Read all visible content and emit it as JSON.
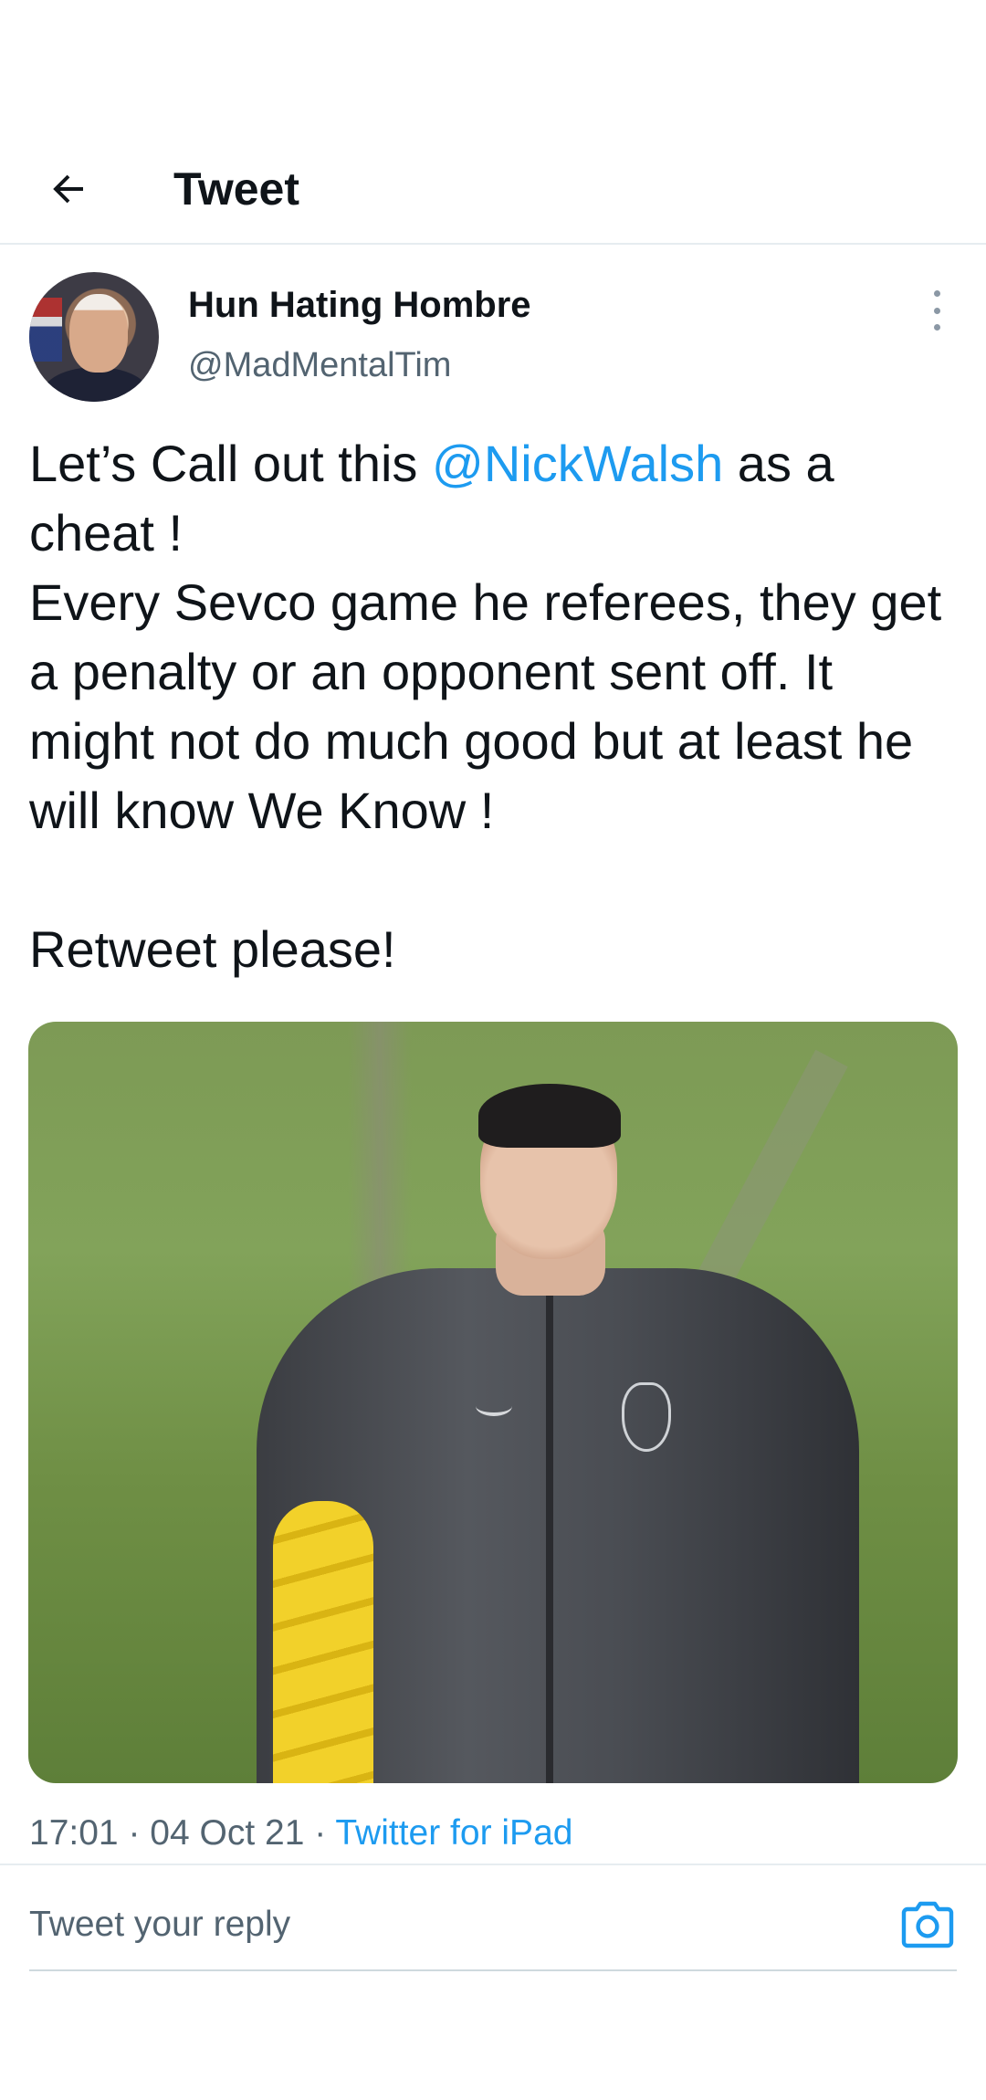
{
  "header": {
    "back_icon": "arrow-left-icon",
    "title": "Tweet"
  },
  "tweet": {
    "author": {
      "display_name": "Hun Hating Hombre",
      "handle": "@MadMentalTim"
    },
    "more_icon": "more-vertical-icon",
    "text_part1": "Let’s Call out this ",
    "mention": "@NickWalsh",
    "text_part2": " as a cheat !\nEvery Sevco game he referees, they get a penalty or an opponent sent off. It might not do much good but at least he will know We Know !\n\nRetweet please!",
    "time": "17:01",
    "date": "04 Oct 21",
    "separator": " · ",
    "source": "Twitter for iPad"
  },
  "reply": {
    "placeholder": "Tweet your reply",
    "camera_icon": "camera-icon"
  },
  "colors": {
    "accent": "#1d9bf0",
    "secondary_text": "#536471",
    "primary_text": "#0f1419"
  }
}
